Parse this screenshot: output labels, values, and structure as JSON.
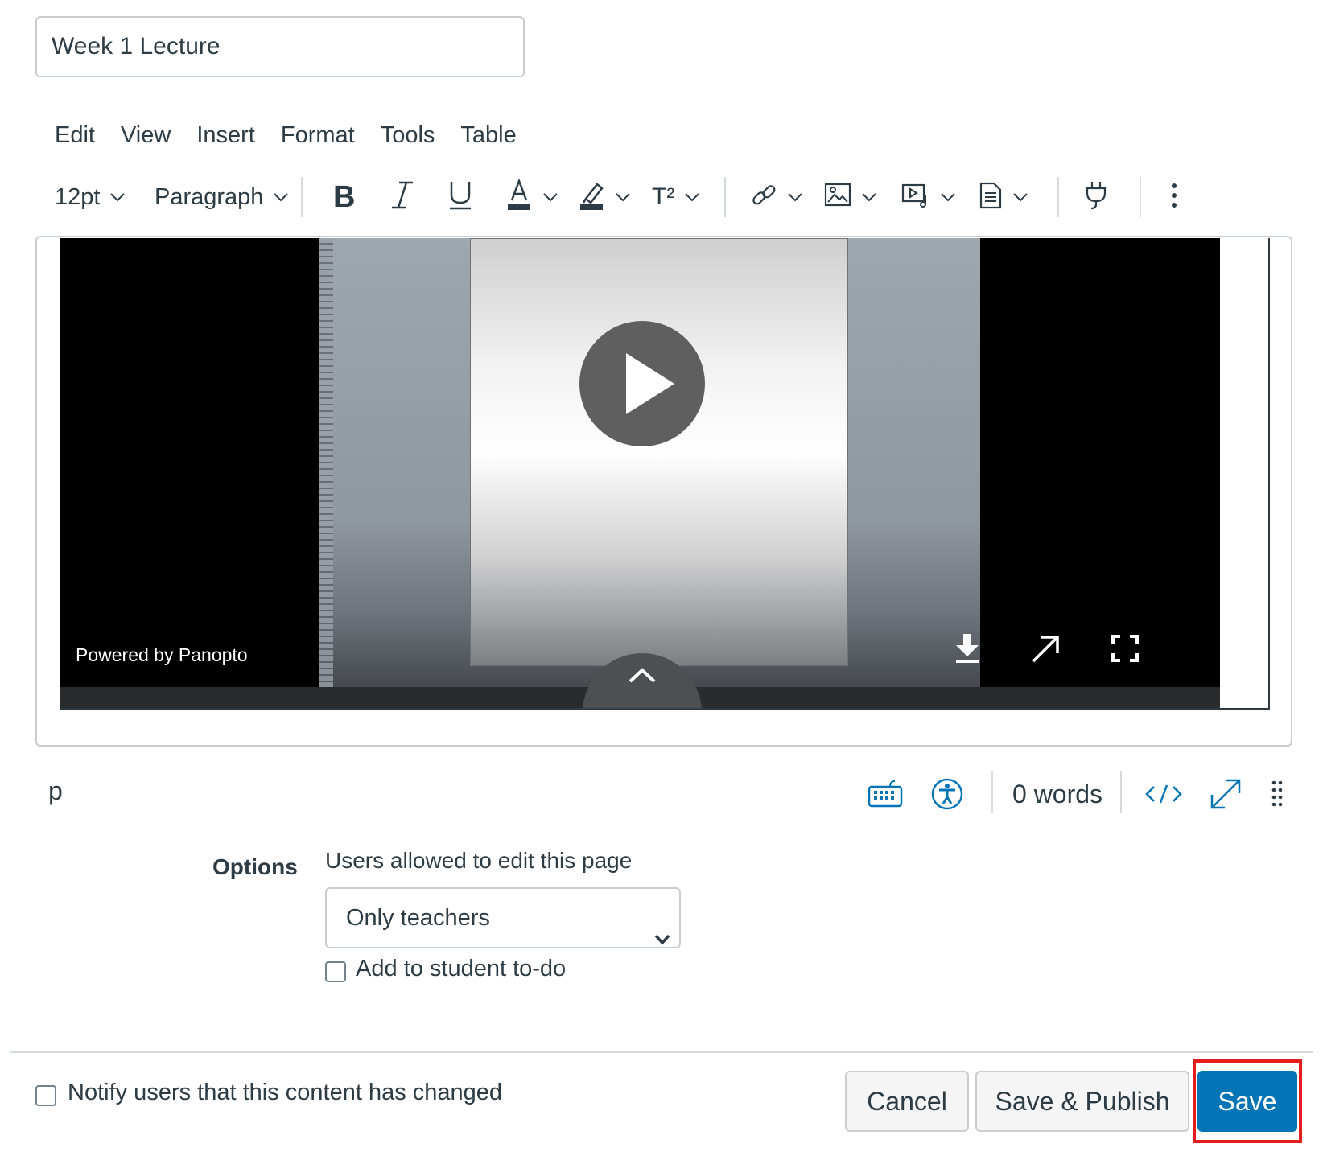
{
  "title_input": {
    "value": "Week 1 Lecture"
  },
  "menubar": [
    "Edit",
    "View",
    "Insert",
    "Format",
    "Tools",
    "Table"
  ],
  "toolbar": {
    "font_size": "12pt",
    "block_format": "Paragraph",
    "superscript_label": "T²",
    "icons": [
      "bold-icon",
      "italic-icon",
      "underline-icon",
      "text-color-icon",
      "highlight-icon",
      "superscript-icon",
      "link-icon",
      "image-icon",
      "media-icon",
      "document-icon",
      "plugin-icon",
      "more-icon"
    ]
  },
  "video": {
    "powered_by": "Powered by Panopto",
    "controls": [
      "download-icon",
      "open-external-icon",
      "fullscreen-icon",
      "play-icon",
      "expand-up-icon"
    ]
  },
  "statusbar": {
    "path": "p",
    "word_count": "0 words",
    "icons": [
      "keyboard-icon",
      "accessibility-icon",
      "html-editor-icon",
      "fullscreen-expand-icon",
      "resize-handle-icon"
    ]
  },
  "options": {
    "section_label": "Options",
    "edit_label": "Users allowed to edit this page",
    "edit_value": "Only teachers",
    "todo_label": "Add to student to-do",
    "todo_checked": false
  },
  "footer": {
    "notify_label": "Notify users that this content has changed",
    "notify_checked": false,
    "cancel": "Cancel",
    "save_publish": "Save & Publish",
    "save": "Save"
  },
  "colors": {
    "primary": "#0374b5",
    "text": "#2d3b45",
    "border": "#c7cdd1",
    "highlight": "#e51c1c"
  }
}
